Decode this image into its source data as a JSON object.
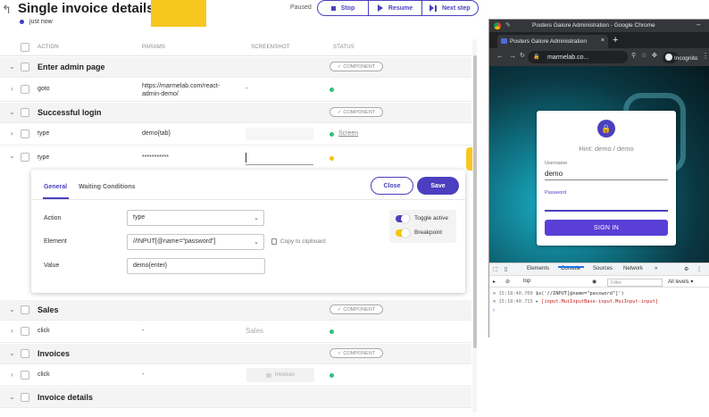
{
  "header": {
    "title": "Single invoice details",
    "save_status": "just now",
    "run_status": "Paused",
    "buttons": {
      "stop": "Stop",
      "resume": "Resume",
      "next": "Next step"
    }
  },
  "table": {
    "columns": {
      "action": "ACTION",
      "params": "PARAMS",
      "screenshot": "SCREENSHOT",
      "status": "STATUS"
    },
    "component_badge": "COMPONENT",
    "groups": {
      "admin": "Enter admin page",
      "login": "Successful login",
      "sales": "Sales",
      "invoices": "Invoices",
      "invoice_details": "Invoice details"
    },
    "steps": {
      "goto": {
        "action": "goto",
        "param_line1": "https://marmelab.com/react-",
        "param_line2": "admin-demo/",
        "screenshot": "-"
      },
      "type1": {
        "action": "type",
        "param": "demo{tab}",
        "screenshot": "Screen"
      },
      "type2": {
        "action": "type",
        "param": "***********"
      },
      "click_sales": {
        "action": "click",
        "param": "-",
        "screenshot": "Sales"
      },
      "click_invoices": {
        "action": "click",
        "param": "-",
        "screenshot": "Invoices"
      }
    }
  },
  "editor": {
    "tabs": {
      "general": "General",
      "waiting": "Waiting Conditions"
    },
    "close_label": "Close",
    "save_label": "Save",
    "fields": {
      "action_label": "Action",
      "action_value": "type",
      "element_label": "Element",
      "element_value": "//INPUT[@name=\"password\"]",
      "value_label": "Value",
      "value_value": "demo{enter}"
    },
    "copy_label": "Copy to clipboard",
    "toggles": {
      "active": "Toggle active",
      "breakpoint": "Breakpoint"
    }
  },
  "chrome": {
    "window_title": "Posters Galore Administration - Google Chrome",
    "tab_title": "Posters Galore Administration",
    "url": "marmelab.co...",
    "incognito": "Incognito",
    "login": {
      "hint": "Hint: demo / demo",
      "username_label": "Username",
      "username_value": "demo",
      "password_label": "Password",
      "signin": "SIGN IN"
    },
    "devtools": {
      "tabs": {
        "elements": "Elements",
        "console": "Console",
        "sources": "Sources",
        "network": "Network",
        "more": "»"
      },
      "context": "top",
      "filter_placeholder": "Filter",
      "levels": "All levels ▾",
      "line1_ts": "15:18:40.700",
      "line1_text": "$x('//INPUT[@name=\"password\"]')",
      "line2_ts": "15:18:40.715",
      "line2_text": "[input.MuiInputBase-input.MuiInput-input]"
    }
  },
  "colors": {
    "accent": "#4b3fbf",
    "highlight": "#f8c71f",
    "success": "#2ec27e"
  }
}
